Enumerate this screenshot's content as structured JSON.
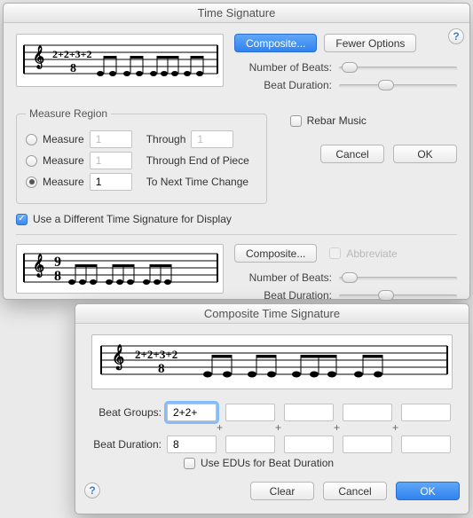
{
  "win1": {
    "title": "Time Signature",
    "help": "?",
    "buttons": {
      "composite": "Composite...",
      "fewer": "Fewer Options"
    },
    "labels": {
      "num_beats": "Number of Beats:",
      "beat_dur": "Beat Duration:",
      "rebar": "Rebar Music",
      "use_diff": "Use a Different Time Signature for Display",
      "abbreviate": "Abbreviate"
    },
    "region": {
      "legend": "Measure Region",
      "rows": [
        {
          "radio": false,
          "label": "Measure",
          "value": "1",
          "through_lbl": "Through",
          "through_val": "1"
        },
        {
          "radio": false,
          "label": "Measure",
          "value": "1",
          "tail": "Through End of Piece"
        },
        {
          "radio": true,
          "label": "Measure",
          "value": "1",
          "tail": "To Next Time Change"
        }
      ]
    },
    "dialog_buttons": {
      "cancel": "Cancel",
      "ok": "OK"
    },
    "display": {
      "composite": "Composite...",
      "num_beats": "Number of Beats:",
      "beat_dur": "Beat Duration:"
    },
    "checks": {
      "use_diff": true,
      "rebar": false,
      "abbreviate": false
    },
    "preview_ts_main": "2+2+3+2",
    "preview_denom_main": "8",
    "preview_ts_disp": "9",
    "preview_denom_disp": "8"
  },
  "win2": {
    "title": "Composite Time Signature",
    "help": "?",
    "labels": {
      "beat_groups": "Beat Groups:",
      "beat_dur": "Beat Duration:",
      "use_edus": "Use EDUs for Beat Duration"
    },
    "groups": [
      "2+2+",
      "",
      "",
      "",
      ""
    ],
    "durations": [
      "8",
      "",
      "",
      "",
      ""
    ],
    "plus": "+",
    "checks": {
      "use_edus": false
    },
    "dialog_buttons": {
      "clear": "Clear",
      "cancel": "Cancel",
      "ok": "OK"
    },
    "preview_ts": "2+2+3+2",
    "preview_denom": "8"
  }
}
